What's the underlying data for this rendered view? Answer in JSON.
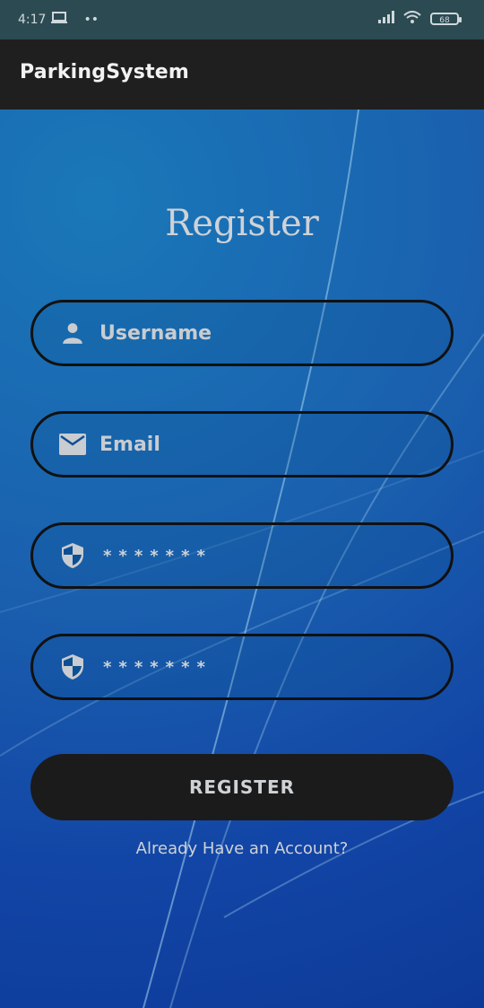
{
  "status_bar": {
    "time": "4:17",
    "notification_dots": "••",
    "battery_level": "68",
    "icons": [
      "laptop-icon",
      "signal-icon",
      "wifi-icon",
      "battery-icon"
    ]
  },
  "app_bar": {
    "title": "ParkingSystem"
  },
  "form": {
    "title": "Register",
    "username_placeholder": "Username",
    "email_placeholder": "Email",
    "password_mask": "*******",
    "confirm_password_mask": "*******",
    "register_label": "REGISTER",
    "login_link": "Already Have an Account?"
  },
  "colors": {
    "status_bar": "#2c4a52",
    "app_bar": "#1f1f1f",
    "background": "#1a5fae",
    "field_border": "#111111",
    "button": "#1b1b1b",
    "text": "#cfd2d6"
  }
}
